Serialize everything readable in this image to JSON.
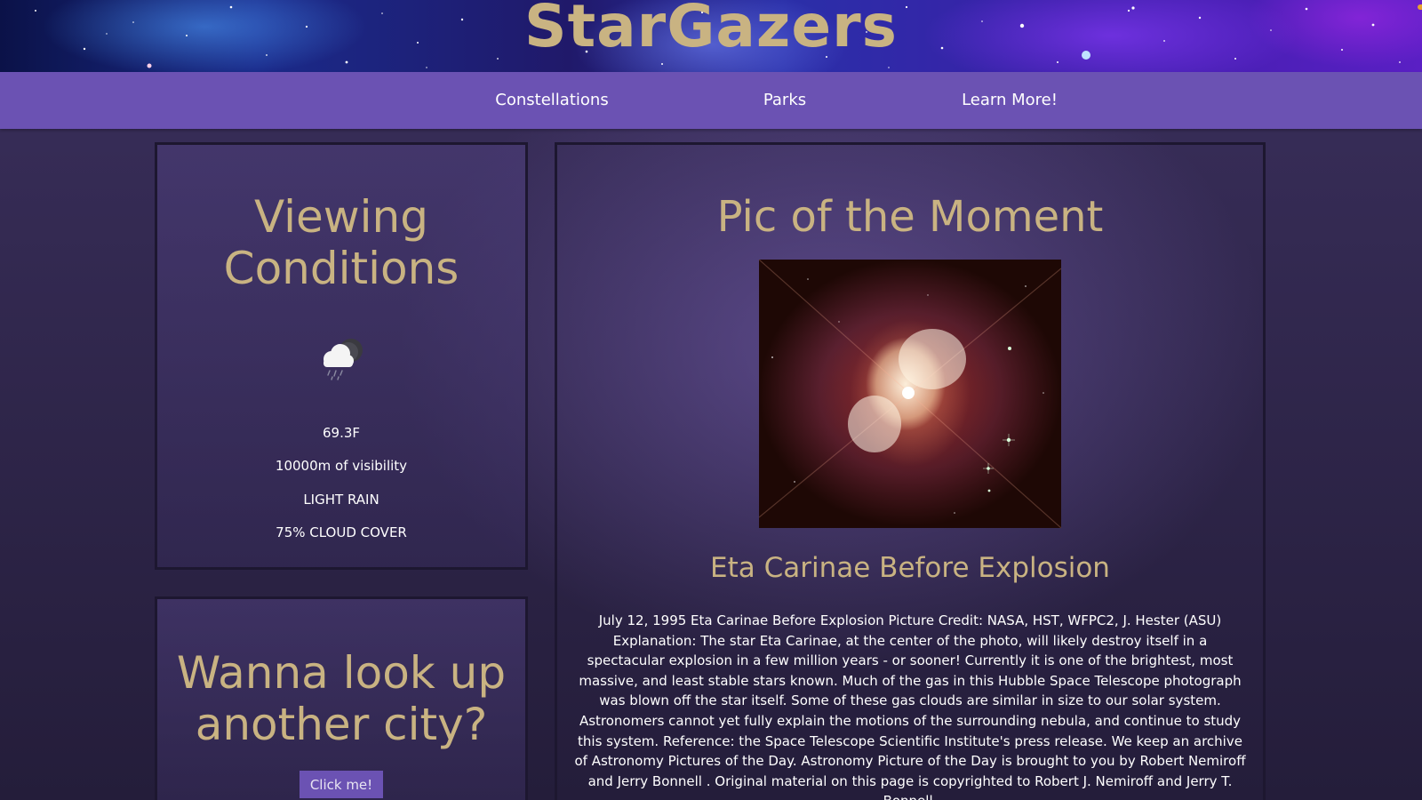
{
  "site": {
    "title": "StarGazers"
  },
  "nav": {
    "items": [
      {
        "label": "Constellations"
      },
      {
        "label": "Parks"
      },
      {
        "label": "Learn More!"
      }
    ]
  },
  "conditions": {
    "heading_line1": "Viewing",
    "heading_line2": "Conditions",
    "icon": "cloud-rain-night-icon",
    "temperature": "69.3F",
    "visibility": "10000m of visibility",
    "description": "LIGHT RAIN",
    "cloud_cover": "75% CLOUD COVER"
  },
  "city_lookup": {
    "heading_line1": "Wanna look up",
    "heading_line2": "another city?",
    "button_label": "Click me!"
  },
  "picture": {
    "heading": "Pic of the Moment",
    "title": "Eta Carinae Before Explosion",
    "explanation": "July 12, 1995 Eta Carinae Before Explosion Picture Credit: NASA, HST, WFPC2, J. Hester (ASU) Explanation: The star Eta Carinae, at the center of the photo, will likely destroy itself in a spectacular explosion in a few million years - or sooner! Currently it is one of the brightest, most massive, and least stable stars known. Much of the gas in this Hubble Space Telescope photograph was blown off the star itself. Some of these gas clouds are similar in size to our solar system. Astronomers cannot yet fully explain the motions of the surrounding nebula, and continue to study this system. Reference: the Space Telescope Scientific Institute's press release. We keep an archive of Astronomy Pictures of the Day. Astronomy Picture of the Day is brought to you by Robert Nemiroff and Jerry Bonnell . Original material on this page is copyrighted to Robert J. Nemiroff and Jerry T. Bonnell."
  },
  "colors": {
    "accent_gold": "#c9b382",
    "nav_purple": "#6b52b3",
    "card_border": "#1d1730",
    "background": "#2e2549"
  }
}
